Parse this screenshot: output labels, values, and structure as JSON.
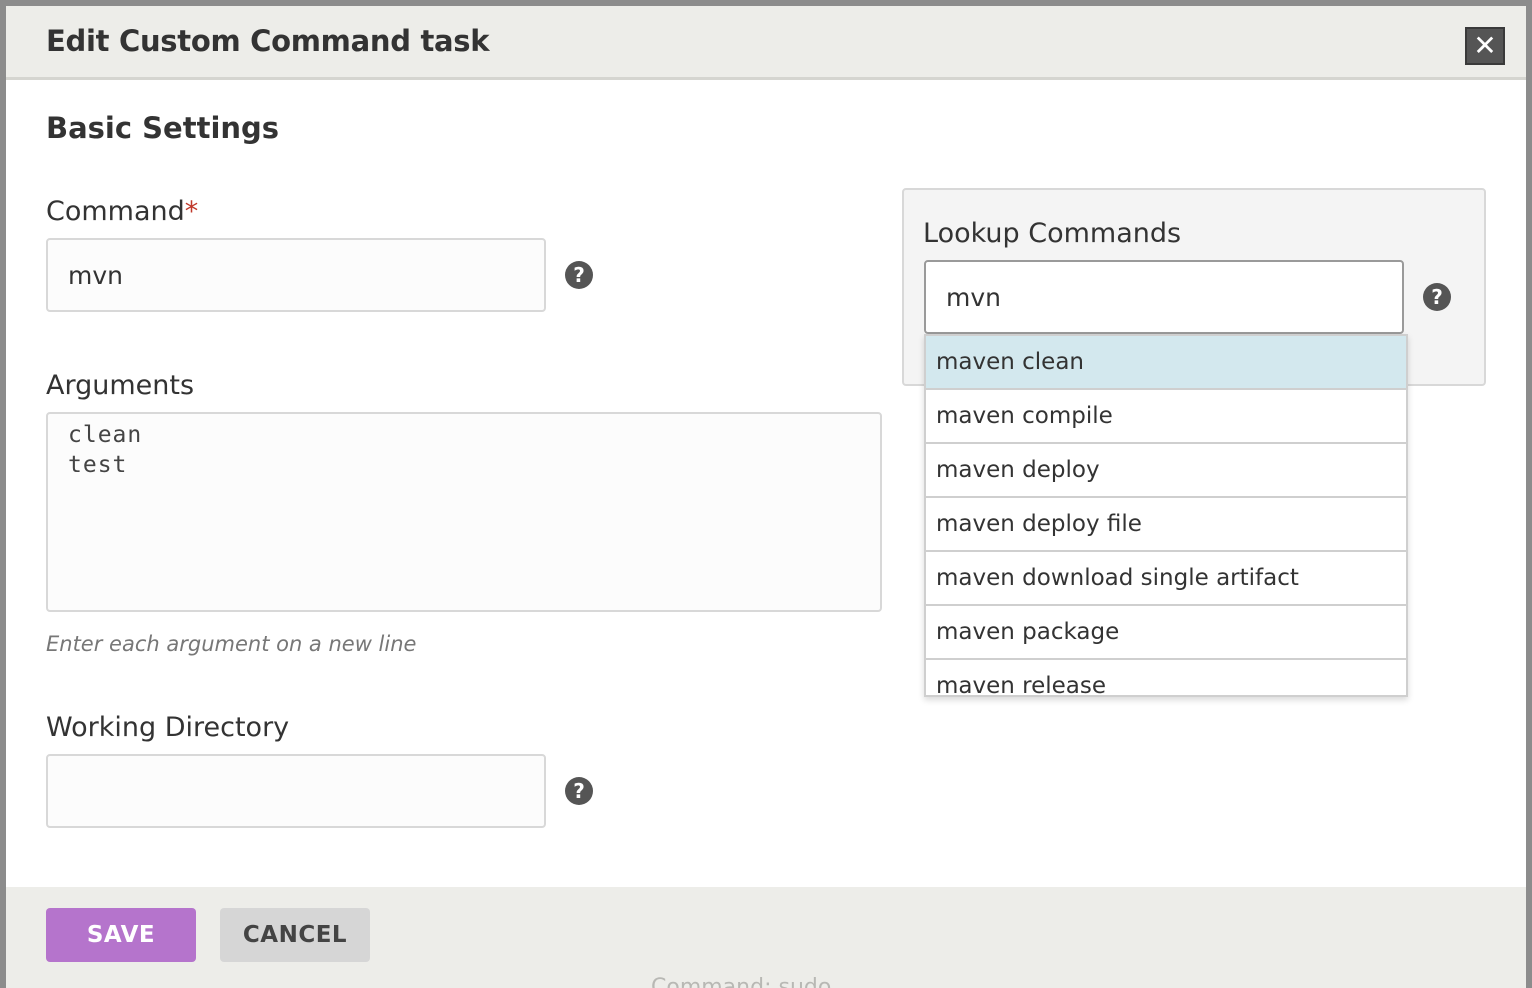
{
  "dialog": {
    "title": "Edit Custom Command task",
    "close_label": "✕"
  },
  "basic_settings": {
    "title": "Basic Settings"
  },
  "command": {
    "label": "Command",
    "required_mark": "*",
    "value": "mvn",
    "help": "?"
  },
  "arguments": {
    "label": "Arguments",
    "lines": [
      "clean",
      "test"
    ],
    "hint": "Enter each argument on a new line"
  },
  "working_directory": {
    "label": "Working Directory",
    "value": "",
    "help": "?"
  },
  "lookup": {
    "label": "Lookup Commands",
    "value": "mvn",
    "help": "?",
    "options": [
      "maven clean",
      "maven compile",
      "maven deploy",
      "maven deploy file",
      "maven download single artifact",
      "maven package",
      "maven release"
    ],
    "highlighted_index": 0
  },
  "footer": {
    "save_label": "SAVE",
    "cancel_label": "CANCEL",
    "background_text": "Command: sudo"
  }
}
